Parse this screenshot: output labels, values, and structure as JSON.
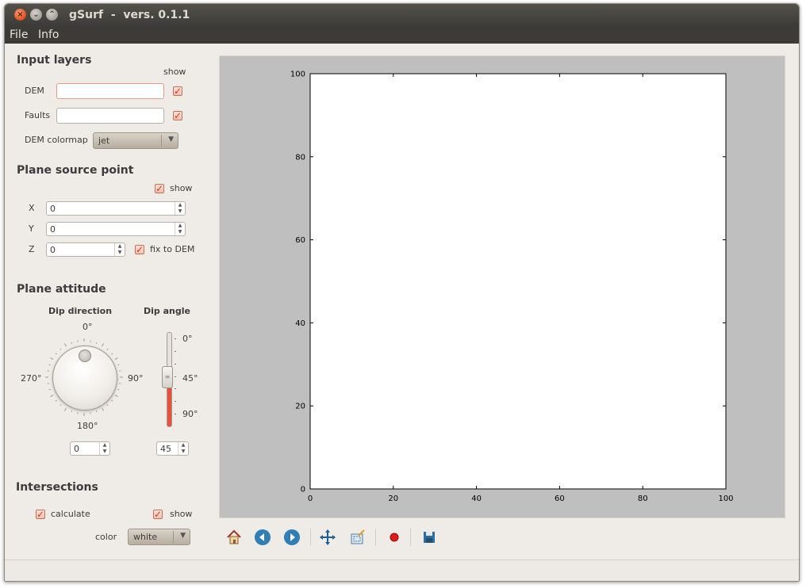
{
  "window": {
    "title": "gSurf  -  vers. 0.1.1",
    "buttons": {
      "close": "×",
      "minimize": "⌄",
      "maximize": "⌃"
    }
  },
  "menu": [
    "File",
    "Info"
  ],
  "input_layers": {
    "title": "Input layers",
    "show_label": "show",
    "dem_label": "DEM",
    "dem_value": "",
    "faults_label": "Faults",
    "faults_value": "",
    "dem_show": true,
    "faults_show": true,
    "colormap_label": "DEM colormap",
    "colormap_value": "jet"
  },
  "plane_source": {
    "title": "Plane source point",
    "show_label": "show",
    "show": true,
    "x_label": "X",
    "x_value": "0",
    "y_label": "Y",
    "y_value": "0",
    "z_label": "Z",
    "z_value": "0",
    "fix_label": "fix  to DEM",
    "fix": true
  },
  "plane_attitude": {
    "title": "Plane attitude",
    "dip_direction_label": "Dip direction",
    "dip_angle_label": "Dip angle",
    "dial_labels": {
      "n": "0°",
      "e": "90°",
      "s": "180°",
      "w": "270°"
    },
    "dip_direction_value": "0",
    "slider_labels": [
      "0°",
      "45°",
      "90°"
    ],
    "dip_angle_value": "45",
    "dip_angle_fraction": 0.5
  },
  "intersections": {
    "title": "Intersections",
    "calculate_label": "calculate",
    "calculate": true,
    "show_label": "show",
    "show": true,
    "color_label": "color",
    "color_value": "white"
  },
  "toolbar": [
    "home-icon",
    "back-icon",
    "forward-icon",
    "pan-icon",
    "zoom-icon",
    "record-icon",
    "save-icon"
  ],
  "chart_data": {
    "type": "scatter",
    "title": "",
    "xlabel": "",
    "ylabel": "",
    "xlim": [
      0,
      100
    ],
    "ylim": [
      0,
      100
    ],
    "x_ticks": [
      "0",
      "20",
      "40",
      "60",
      "80",
      "100"
    ],
    "y_ticks": [
      "0",
      "20",
      "40",
      "60",
      "80",
      "100"
    ],
    "series": [],
    "grid": false
  }
}
